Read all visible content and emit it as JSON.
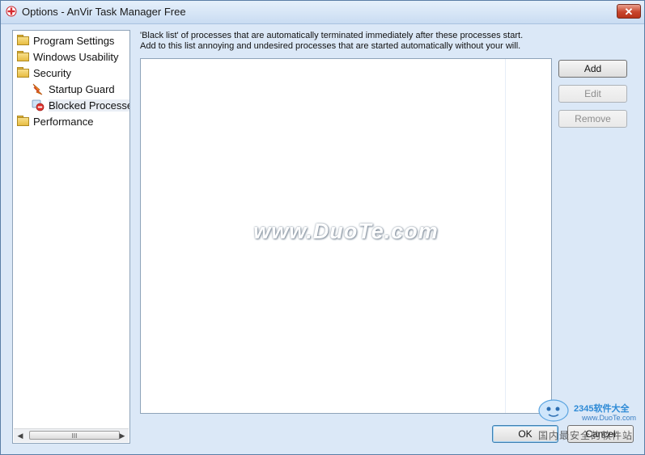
{
  "window": {
    "title": "Options - AnVir Task Manager Free",
    "close_label": "✕"
  },
  "tree": {
    "items": [
      {
        "label": "Program Settings",
        "icon": "folder-icon"
      },
      {
        "label": "Windows Usability",
        "icon": "folder-icon"
      },
      {
        "label": "Security",
        "icon": "folder-icon"
      },
      {
        "label": "Startup Guard",
        "icon": "startup-guard-icon"
      },
      {
        "label": "Blocked Processes",
        "icon": "blocked-processes-icon",
        "selected": true
      },
      {
        "label": "Performance",
        "icon": "folder-icon"
      }
    ],
    "scroll_left": "◀",
    "scroll_right": "▶",
    "scroll_thumb": "III"
  },
  "content": {
    "description_line1": "'Black list' of processes that are automatically terminated immediately after these processes start.",
    "description_line2": "Add to this list annoying and undesired processes that are started automatically without your will."
  },
  "buttons": {
    "add": "Add",
    "edit": "Edit",
    "remove": "Remove",
    "ok": "OK",
    "cancel": "Cancel"
  },
  "watermarks": {
    "center": "www.DuoTe.com",
    "corner_brand": "2345软件大全",
    "corner_site": "www.DuoTe.com",
    "corner_overlay": "国内最安全的软件站"
  },
  "colors": {
    "window_bg": "#dbe8f7",
    "close_red": "#c8452c",
    "selected_bg": "#e9eef5"
  }
}
